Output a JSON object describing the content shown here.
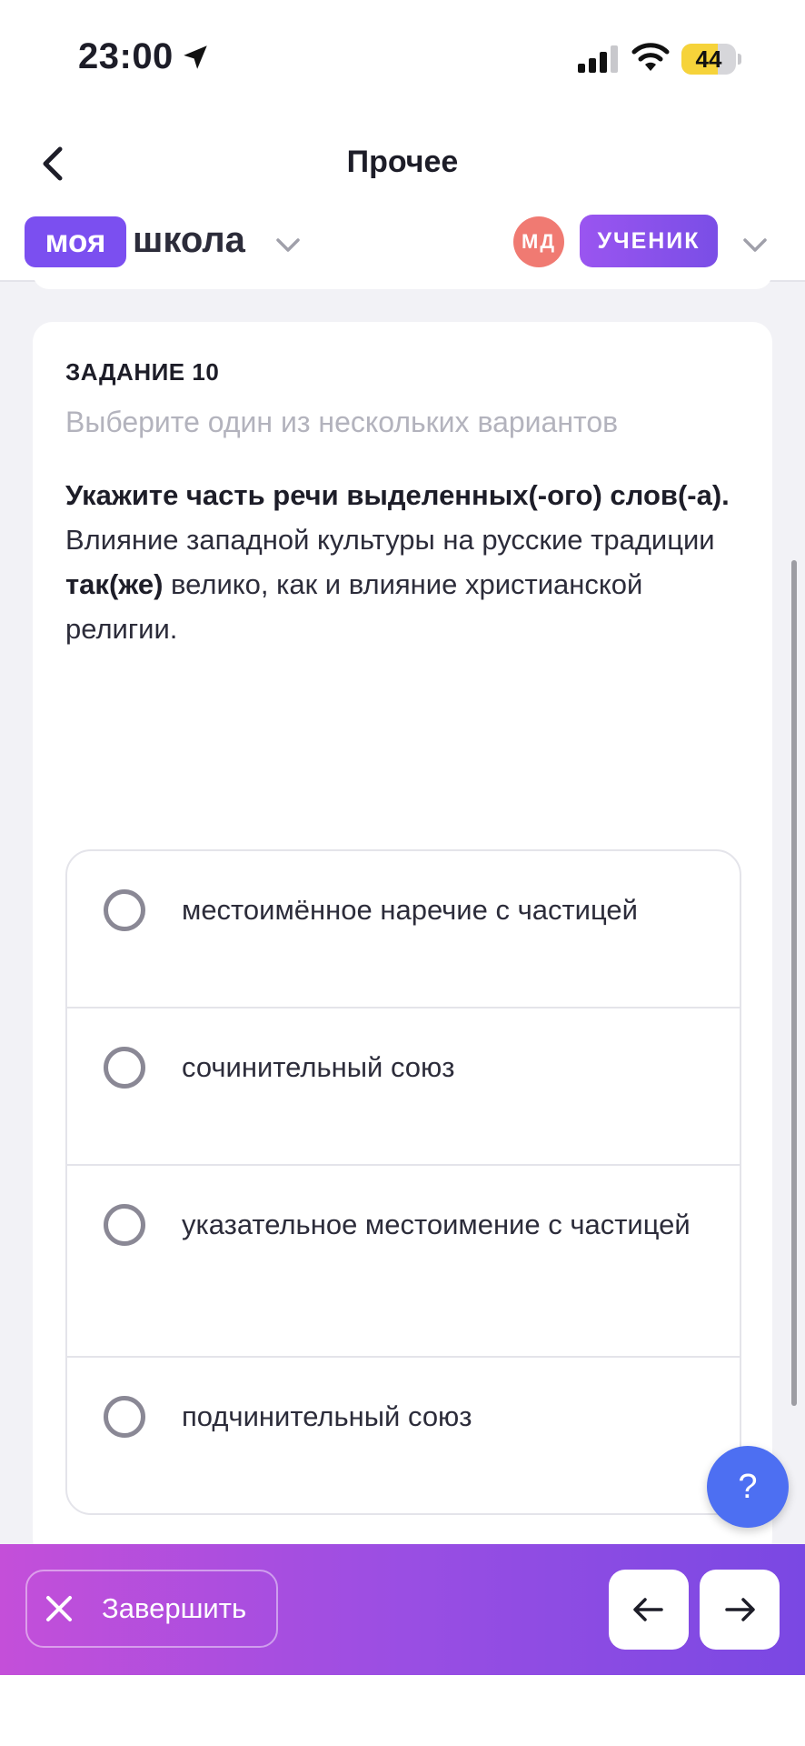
{
  "status_bar": {
    "time": "23:00",
    "battery": "44",
    "icons": [
      "location-arrow-icon",
      "cellular-signal-icon",
      "wifi-icon",
      "battery-icon"
    ]
  },
  "nav": {
    "title": "Прочее",
    "back_icon": "chevron-left-icon"
  },
  "header": {
    "logo_badge": "моя",
    "logo_text": "школа",
    "avatar_initials": "МД",
    "role": "УЧЕНИК",
    "colors": {
      "brand": "#7b4ff0",
      "avatar": "#f07a72"
    }
  },
  "task": {
    "title": "ЗАДАНИЕ 10",
    "hint": "Выберите один из нескольких вариантов",
    "question_bold": "Укажите часть речи выделенных(-ого) слов(-а).",
    "sentence_before": "Влияние западной культуры на русские традиции ",
    "sentence_marked": "так(же)",
    "sentence_after": " велико, как и влияние христианской религии.",
    "options": [
      {
        "label": "местоимённое наречие с частицей"
      },
      {
        "label": "сочинительный союз"
      },
      {
        "label": "указательное местоимение с частицей"
      },
      {
        "label": "подчинительный союз"
      }
    ]
  },
  "help": {
    "label": "?"
  },
  "footer": {
    "finish_label": "Завершить",
    "prev_icon": "arrow-left-icon",
    "next_icon": "arrow-right-icon"
  }
}
